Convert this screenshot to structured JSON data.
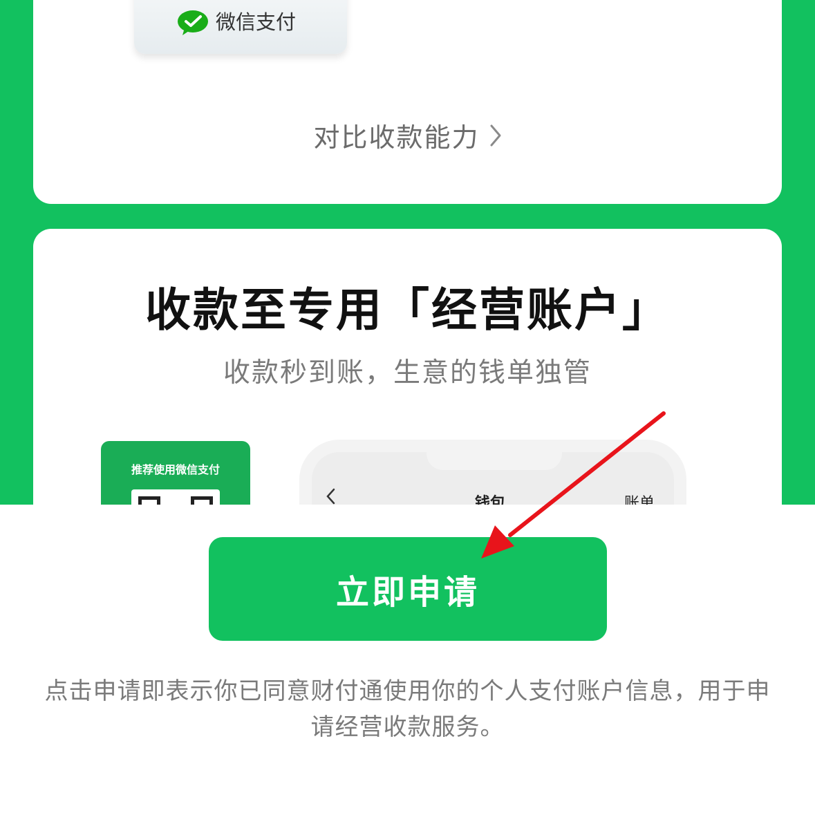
{
  "colors": {
    "brand_green": "#12c15f",
    "text_dark": "#111111",
    "text_gray": "#7a7a7a",
    "annotation_red": "#e8141b"
  },
  "top_card": {
    "pay_badge_label": "微信支付",
    "pay_badge_icon": "wechat-pay-icon",
    "compare_link": "对比收款能力"
  },
  "feature_card": {
    "title": "收款至专用「经营账户」",
    "subtitle": "收款秒到账，生意的钱单独管",
    "qr_card_label": "推荐使用微信支付",
    "phone_screen": {
      "title": "钱包",
      "bills": "账单"
    }
  },
  "footer": {
    "apply_button": "立即申请",
    "disclaimer": "点击申请即表示你已同意财付通使用你的个人支付账户信息，用于申请经营收款服务。"
  }
}
